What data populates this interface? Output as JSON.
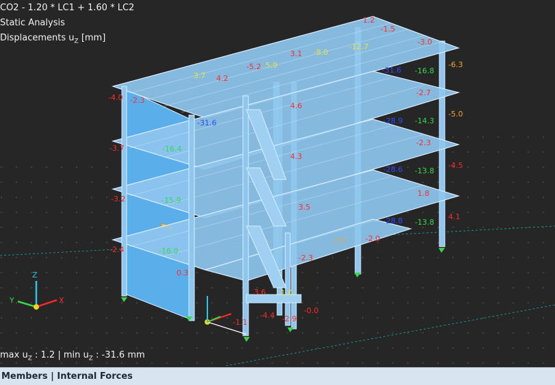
{
  "header": {
    "load_combination": "CO2 - 1.20 * LC1 + 1.60 * LC2",
    "analysis_type": "Static Analysis",
    "result_label": "Displacements u",
    "result_sub": "Z",
    "result_unit": " [mm]"
  },
  "summary": {
    "max_label": "max u",
    "max_sub": "Z",
    "max_value": " : 1.2 | min u",
    "min_sub": "Z",
    "min_value": " : -31.6 mm"
  },
  "bottom_panel": {
    "title": "Members | Internal Forces"
  },
  "axes": {
    "x": "X",
    "y": "Y",
    "z": "Z"
  },
  "colors": {
    "background": "#262626",
    "structure_fill": "#8ec6ee",
    "structure_edge": "#d8eeff",
    "red": "#ff2b2b",
    "orange": "#f5a623",
    "green": "#38d84a",
    "cyan": "#2bc8e8",
    "blue": "#2f4cff",
    "yellow": "#e8e23a"
  },
  "labels": [
    {
      "text": "1.2",
      "color": "red"
    },
    {
      "text": "-1.5",
      "color": "red"
    },
    {
      "text": "-3.0",
      "color": "red"
    },
    {
      "text": "-6.3",
      "color": "orange"
    },
    {
      "text": "3.1",
      "color": "red"
    },
    {
      "text": "-8.0",
      "color": "yellow"
    },
    {
      "text": "-12.7",
      "color": "yellow"
    },
    {
      "text": "-5.2",
      "color": "red"
    },
    {
      "text": "5.9",
      "color": "yellow"
    },
    {
      "text": "-31.6",
      "color": "blue"
    },
    {
      "text": "-16.8",
      "color": "green"
    },
    {
      "text": "3.7",
      "color": "yellow"
    },
    {
      "text": "4.2",
      "color": "red"
    },
    {
      "text": "-4.0",
      "color": "red"
    },
    {
      "text": "-2.3",
      "color": "red"
    },
    {
      "text": "-2.7",
      "color": "red"
    },
    {
      "text": "4.6",
      "color": "red"
    },
    {
      "text": "-5.0",
      "color": "orange"
    },
    {
      "text": "-31.6",
      "color": "blue"
    },
    {
      "text": "-28.9",
      "color": "blue"
    },
    {
      "text": "-14.3",
      "color": "green"
    },
    {
      "text": "-3.7",
      "color": "red"
    },
    {
      "text": "-16.4",
      "color": "green"
    },
    {
      "text": "4.3",
      "color": "red"
    },
    {
      "text": "-2.3",
      "color": "red"
    },
    {
      "text": "-4.5",
      "color": "red"
    },
    {
      "text": "-28.6",
      "color": "blue"
    },
    {
      "text": "-13.8",
      "color": "green"
    },
    {
      "text": "-3.2",
      "color": "red"
    },
    {
      "text": "-15.9",
      "color": "green"
    },
    {
      "text": "3.5",
      "color": "red"
    },
    {
      "text": "1.8",
      "color": "red"
    },
    {
      "text": "4.1",
      "color": "red"
    },
    {
      "text": "-28.8",
      "color": "blue"
    },
    {
      "text": "-13.8",
      "color": "green"
    },
    {
      "text": "-2.4",
      "color": "red"
    },
    {
      "text": "-16.0",
      "color": "green"
    },
    {
      "text": "-7.7",
      "color": "orange"
    },
    {
      "text": "-2.0",
      "color": "red"
    },
    {
      "text": "0.3",
      "color": "red"
    },
    {
      "text": "-2.3",
      "color": "red"
    },
    {
      "text": "3.6",
      "color": "red"
    },
    {
      "text": "1.0",
      "color": "yellow"
    },
    {
      "text": "-4.4",
      "color": "red"
    },
    {
      "text": "-2.9",
      "color": "red"
    },
    {
      "text": "-0.0",
      "color": "red"
    },
    {
      "text": "-1.1",
      "color": "red"
    }
  ]
}
